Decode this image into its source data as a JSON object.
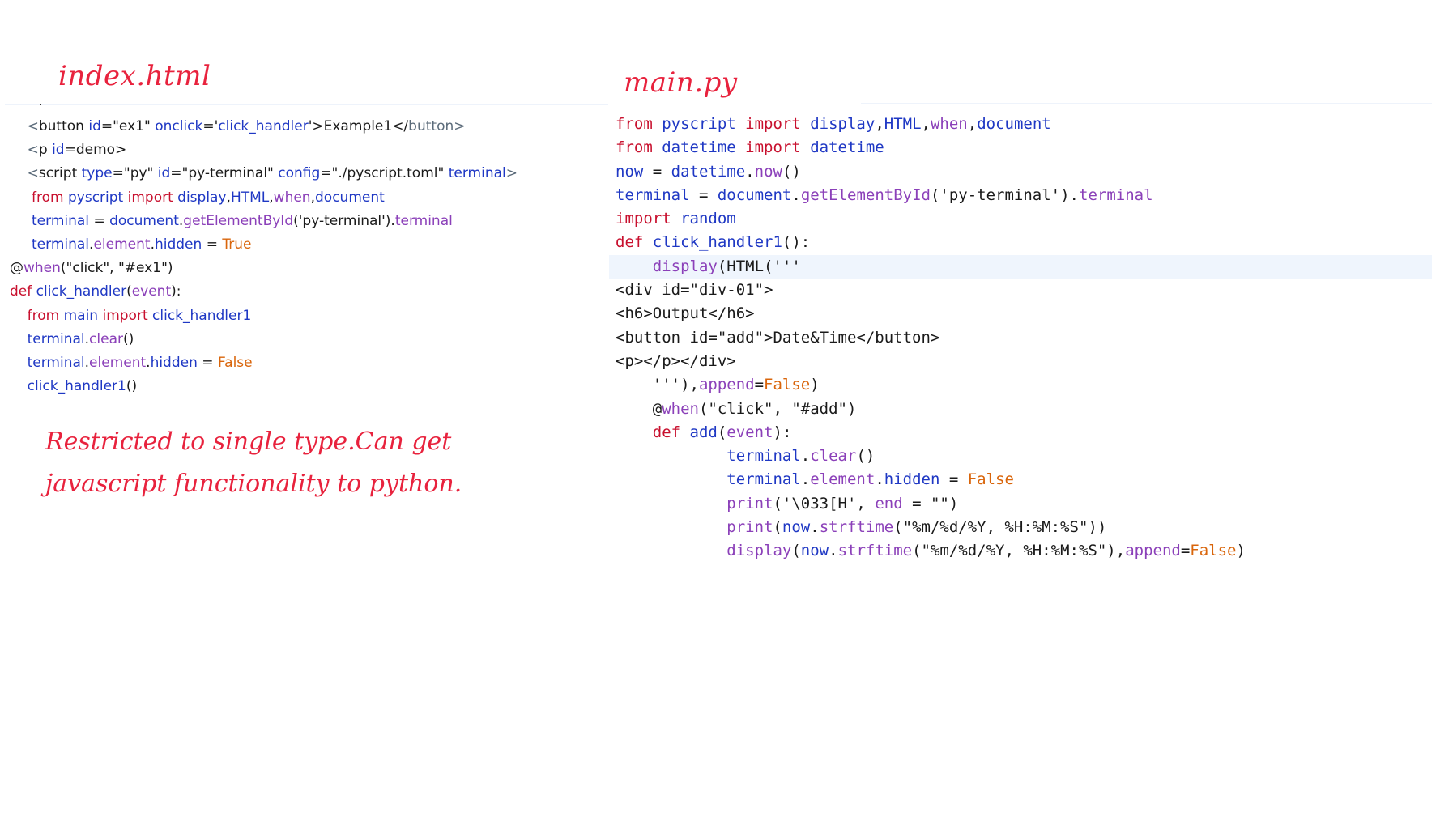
{
  "titles": {
    "left": "index.html",
    "right": "main.py"
  },
  "colors": {
    "title_red": "#e8223d",
    "keyword": "#c8102e",
    "identifier": "#1f38c4",
    "purple": "#8b40b9",
    "constant": "#d9650b"
  },
  "left_code": [
    [
      {
        "c": "g",
        "t": "    <"
      },
      {
        "c": "t",
        "t": "button "
      },
      {
        "c": "b",
        "t": "id"
      },
      {
        "c": "t",
        "t": "=\"ex1\" "
      },
      {
        "c": "b",
        "t": "onclick"
      },
      {
        "c": "t",
        "t": "='"
      },
      {
        "c": "b",
        "t": "click_handler"
      },
      {
        "c": "t",
        "t": "'>Example1</"
      },
      {
        "c": "g",
        "t": "button>"
      }
    ],
    [
      {
        "c": "g",
        "t": "    <"
      },
      {
        "c": "t",
        "t": "p "
      },
      {
        "c": "b",
        "t": "id"
      },
      {
        "c": "t",
        "t": "=demo>"
      }
    ],
    [
      {
        "c": "g",
        "t": "    <"
      },
      {
        "c": "t",
        "t": "script "
      },
      {
        "c": "b",
        "t": "type"
      },
      {
        "c": "t",
        "t": "=\"py\" "
      },
      {
        "c": "b",
        "t": "id"
      },
      {
        "c": "t",
        "t": "=\"py-terminal\" "
      },
      {
        "c": "b",
        "t": "config"
      },
      {
        "c": "t",
        "t": "=\"./pyscript.toml\" "
      },
      {
        "c": "b",
        "t": "terminal"
      },
      {
        "c": "g",
        "t": ">"
      }
    ],
    [
      {
        "c": "k",
        "t": "     from "
      },
      {
        "c": "b",
        "t": "pyscript "
      },
      {
        "c": "k",
        "t": "import "
      },
      {
        "c": "b",
        "t": "display"
      },
      {
        "c": "t",
        "t": ","
      },
      {
        "c": "b",
        "t": "HTML"
      },
      {
        "c": "t",
        "t": ","
      },
      {
        "c": "p",
        "t": "when"
      },
      {
        "c": "t",
        "t": ","
      },
      {
        "c": "b",
        "t": "document"
      }
    ],
    [
      {
        "c": "b",
        "t": "     terminal "
      },
      {
        "c": "t",
        "t": "= "
      },
      {
        "c": "b",
        "t": "document"
      },
      {
        "c": "t",
        "t": "."
      },
      {
        "c": "p",
        "t": "getElementById"
      },
      {
        "c": "t",
        "t": "('py-terminal')."
      },
      {
        "c": "p",
        "t": "terminal"
      }
    ],
    [
      {
        "c": "b",
        "t": "     terminal"
      },
      {
        "c": "t",
        "t": "."
      },
      {
        "c": "p",
        "t": "element"
      },
      {
        "c": "t",
        "t": "."
      },
      {
        "c": "b",
        "t": "hidden "
      },
      {
        "c": "t",
        "t": "= "
      },
      {
        "c": "o",
        "t": "True"
      }
    ],
    [
      {
        "c": "t",
        "t": "@"
      },
      {
        "c": "p",
        "t": "when"
      },
      {
        "c": "t",
        "t": "(\"click\", \"#ex1\")"
      }
    ],
    [
      {
        "c": "k",
        "t": "def "
      },
      {
        "c": "b",
        "t": "click_handler"
      },
      {
        "c": "t",
        "t": "("
      },
      {
        "c": "p",
        "t": "event"
      },
      {
        "c": "t",
        "t": "):"
      }
    ],
    [
      {
        "c": "k",
        "t": "    from "
      },
      {
        "c": "b",
        "t": "main "
      },
      {
        "c": "k",
        "t": "import "
      },
      {
        "c": "b",
        "t": "click_handler1"
      }
    ],
    [
      {
        "c": "b",
        "t": "    terminal"
      },
      {
        "c": "t",
        "t": "."
      },
      {
        "c": "p",
        "t": "clear"
      },
      {
        "c": "t",
        "t": "()"
      }
    ],
    [
      {
        "c": "b",
        "t": "    terminal"
      },
      {
        "c": "t",
        "t": "."
      },
      {
        "c": "p",
        "t": "element"
      },
      {
        "c": "t",
        "t": "."
      },
      {
        "c": "b",
        "t": "hidden "
      },
      {
        "c": "t",
        "t": "= "
      },
      {
        "c": "o",
        "t": "False"
      }
    ],
    [
      {
        "c": "b",
        "t": "    click_handler1"
      },
      {
        "c": "t",
        "t": "()"
      }
    ]
  ],
  "right_code": [
    [
      {
        "c": "k",
        "t": "from "
      },
      {
        "c": "b",
        "t": "pyscript "
      },
      {
        "c": "k",
        "t": "import "
      },
      {
        "c": "b",
        "t": "display"
      },
      {
        "c": "t",
        "t": ","
      },
      {
        "c": "b",
        "t": "HTML"
      },
      {
        "c": "t",
        "t": ","
      },
      {
        "c": "p",
        "t": "when"
      },
      {
        "c": "t",
        "t": ","
      },
      {
        "c": "b",
        "t": "document"
      }
    ],
    [
      {
        "c": "k",
        "t": "from "
      },
      {
        "c": "b",
        "t": "datetime "
      },
      {
        "c": "k",
        "t": "import "
      },
      {
        "c": "b",
        "t": "datetime"
      }
    ],
    [
      {
        "c": "b",
        "t": "now "
      },
      {
        "c": "t",
        "t": "= "
      },
      {
        "c": "b",
        "t": "datetime"
      },
      {
        "c": "t",
        "t": "."
      },
      {
        "c": "p",
        "t": "now"
      },
      {
        "c": "t",
        "t": "()"
      }
    ],
    [
      {
        "c": "b",
        "t": "terminal "
      },
      {
        "c": "t",
        "t": "= "
      },
      {
        "c": "b",
        "t": "document"
      },
      {
        "c": "t",
        "t": "."
      },
      {
        "c": "p",
        "t": "getElementById"
      },
      {
        "c": "t",
        "t": "('py-terminal')."
      },
      {
        "c": "p",
        "t": "terminal"
      }
    ],
    [
      {
        "c": "k",
        "t": "import "
      },
      {
        "c": "b",
        "t": "random"
      }
    ],
    [
      {
        "c": "k",
        "t": "def "
      },
      {
        "c": "b",
        "t": "click_handler1"
      },
      {
        "c": "t",
        "t": "():"
      }
    ],
    [
      {
        "c": "p",
        "t": "    display"
      },
      {
        "c": "t",
        "t": "(HTML('''"
      }
    ],
    [
      {
        "c": "t",
        "t": "<div id=\"div-01\">"
      }
    ],
    [
      {
        "c": "t",
        "t": "<h6>Output</h6>"
      }
    ],
    [
      {
        "c": "t",
        "t": "<button id=\"add\">Date&Time</button>"
      }
    ],
    [
      {
        "c": "t",
        "t": "<p></p></div>"
      }
    ],
    [
      {
        "c": "t",
        "t": "    '''),"
      },
      {
        "c": "p",
        "t": "append"
      },
      {
        "c": "t",
        "t": "="
      },
      {
        "c": "o",
        "t": "False"
      },
      {
        "c": "t",
        "t": ")"
      }
    ],
    [
      {
        "c": "t",
        "t": "    @"
      },
      {
        "c": "p",
        "t": "when"
      },
      {
        "c": "t",
        "t": "(\"click\", \"#add\")"
      }
    ],
    [
      {
        "c": "k",
        "t": "    def "
      },
      {
        "c": "b",
        "t": "add"
      },
      {
        "c": "t",
        "t": "("
      },
      {
        "c": "p",
        "t": "event"
      },
      {
        "c": "t",
        "t": "):"
      }
    ],
    [
      {
        "c": "b",
        "t": "            terminal"
      },
      {
        "c": "t",
        "t": "."
      },
      {
        "c": "p",
        "t": "clear"
      },
      {
        "c": "t",
        "t": "()"
      }
    ],
    [
      {
        "c": "b",
        "t": "            terminal"
      },
      {
        "c": "t",
        "t": "."
      },
      {
        "c": "p",
        "t": "element"
      },
      {
        "c": "t",
        "t": "."
      },
      {
        "c": "b",
        "t": "hidden "
      },
      {
        "c": "t",
        "t": "= "
      },
      {
        "c": "o",
        "t": "False"
      }
    ],
    [
      {
        "c": "p",
        "t": "            print"
      },
      {
        "c": "t",
        "t": "('\\033[H', "
      },
      {
        "c": "p",
        "t": "end "
      },
      {
        "c": "t",
        "t": "= \"\")"
      }
    ],
    [
      {
        "c": "p",
        "t": "            print"
      },
      {
        "c": "t",
        "t": "("
      },
      {
        "c": "b",
        "t": "now"
      },
      {
        "c": "t",
        "t": "."
      },
      {
        "c": "p",
        "t": "strftime"
      },
      {
        "c": "t",
        "t": "(\"%m/%d/%Y, %H:%M:%S\"))"
      }
    ],
    [
      {
        "c": "p",
        "t": "            display"
      },
      {
        "c": "t",
        "t": "("
      },
      {
        "c": "b",
        "t": "now"
      },
      {
        "c": "t",
        "t": "."
      },
      {
        "c": "p",
        "t": "strftime"
      },
      {
        "c": "t",
        "t": "(\"%m/%d/%Y, %H:%M:%S\"),"
      },
      {
        "c": "p",
        "t": "append"
      },
      {
        "c": "t",
        "t": "="
      },
      {
        "c": "o",
        "t": "False"
      },
      {
        "c": "t",
        "t": ")"
      }
    ]
  ],
  "right_highlight_line": 6,
  "note": {
    "line1": "Restricted to single type.Can get",
    "line2": "javascript functionality to python."
  }
}
